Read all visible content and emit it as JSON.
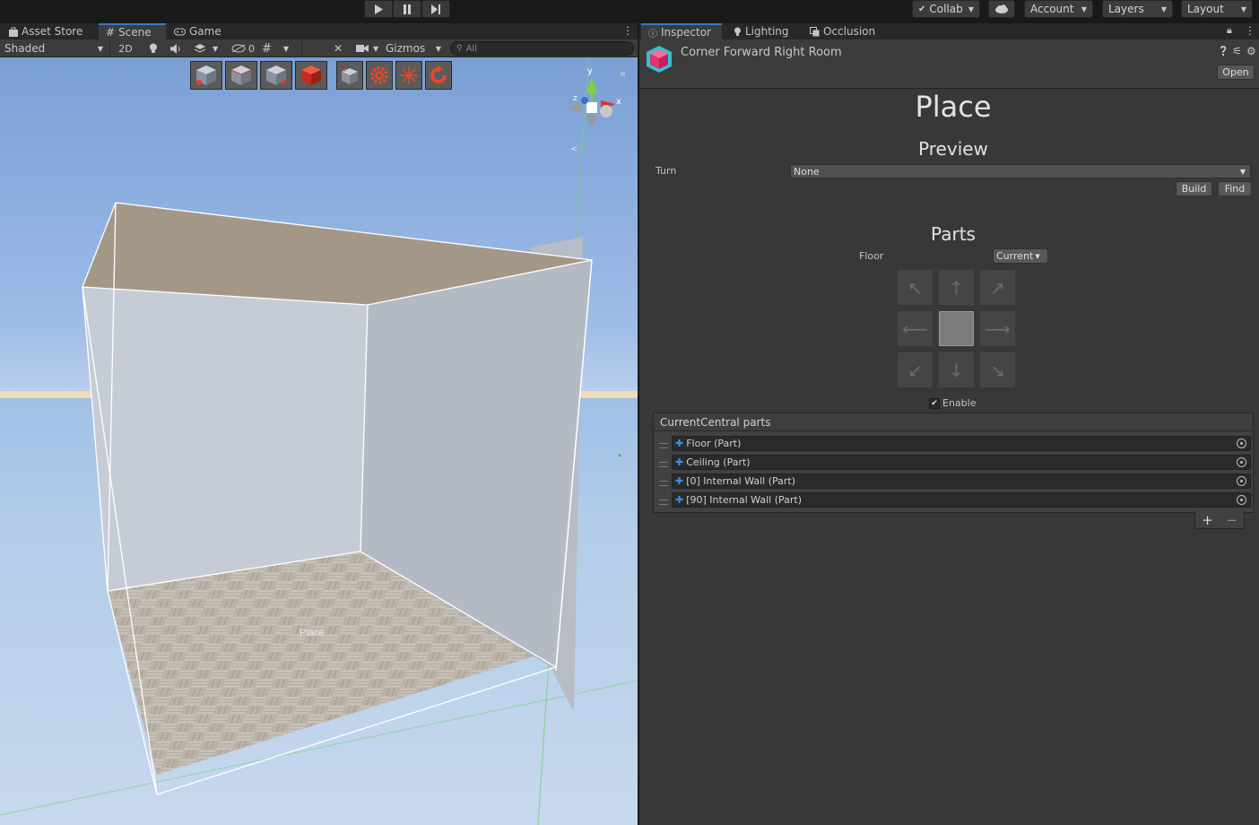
{
  "topbar": {
    "collab_label": "Collab",
    "account_label": "Account",
    "layers_label": "Layers",
    "layout_label": "Layout"
  },
  "left_tabs": [
    "Asset Store",
    "Scene",
    "Game"
  ],
  "scene_toolbar": {
    "shading_mode": "Shaded",
    "mode_2d": "2D",
    "hidden_count": "0",
    "gizmos_label": "Gizmos",
    "search_placeholder": "All"
  },
  "viewport": {
    "object_label": "Place",
    "gizmo_axes": {
      "y": "y",
      "x": "x",
      "z": "z"
    }
  },
  "right_tabs": [
    "Inspector",
    "Lighting",
    "Occlusion"
  ],
  "inspector": {
    "object_name": "Corner Forward Right Room",
    "open_button": "Open",
    "title": "Place",
    "preview_heading": "Preview",
    "turn_label": "Turn",
    "turn_value": "None",
    "build_button": "Build",
    "find_button": "Find",
    "parts_heading": "Parts",
    "floor_label": "Floor",
    "floor_value": "Current",
    "enable_label": "Enable",
    "enable_checked": true,
    "list_header": "CurrentCentral parts",
    "parts": [
      "Floor (Part)",
      "Ceiling (Part)",
      "[0] Internal Wall (Part)",
      "[90] Internal Wall (Part)"
    ],
    "add_label": "+",
    "remove_label": "−"
  },
  "colors": {
    "accent": "#3a79bb",
    "panel_bg": "#383838",
    "ceiling": "#a39888",
    "wall": "#c3c9d3",
    "floor": "#b8b0a4",
    "part_icon": "#3a8ee6"
  }
}
